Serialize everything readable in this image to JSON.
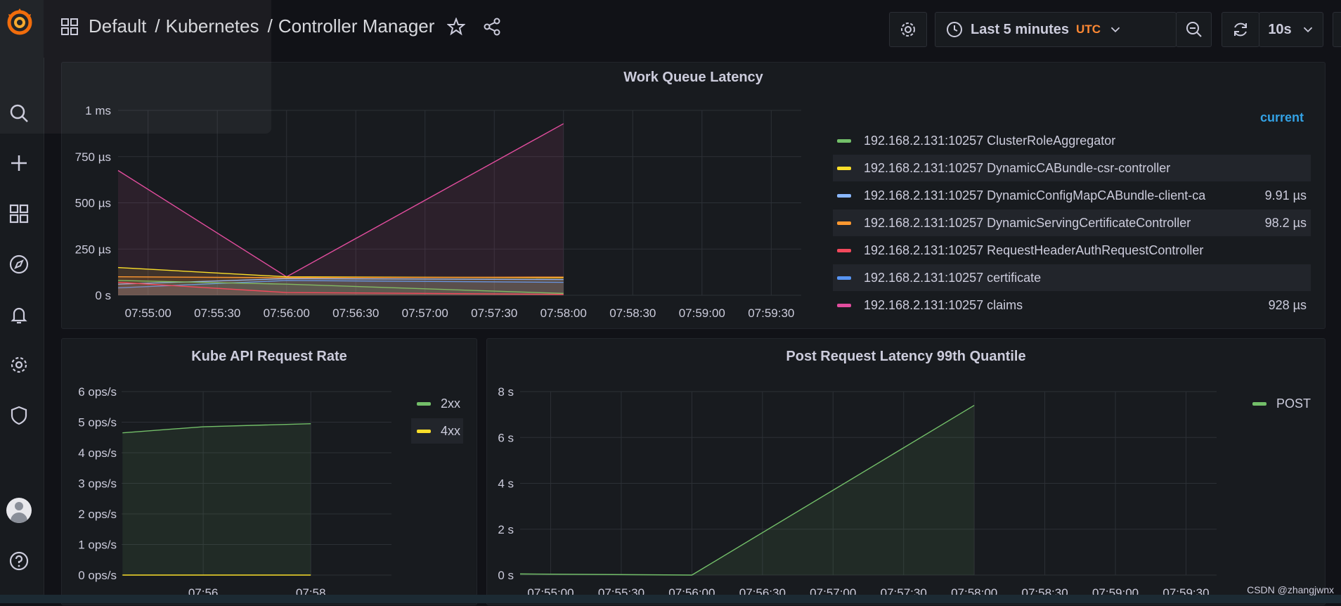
{
  "breadcrumb": {
    "folder": "Default",
    "sep1": "/",
    "parent": "Kubernetes",
    "sep2": "/",
    "dashboard": "Controller Manager"
  },
  "toolbar": {
    "time_range_label": "Last 5 minutes",
    "timezone": "UTC",
    "refresh_interval": "10s"
  },
  "sidebar": {
    "items": [
      "grafana-logo-icon",
      "search-icon",
      "plus-icon",
      "dashboards-icon",
      "explore-icon",
      "alerting-icon",
      "configuration-icon",
      "shield-icon",
      "avatar",
      "help-icon"
    ]
  },
  "colors": {
    "green": "#73bf69",
    "yellow": "#fade2a",
    "cyan": "#8ab8ff",
    "orange": "#ff9830",
    "red": "#f2495c",
    "blue": "#5794f2",
    "pink": "#e24d9e",
    "accent": "#33a2e5",
    "utc": "#ff8833"
  },
  "panels": {
    "work_queue": {
      "title": "Work Queue Latency",
      "legend_header": "current",
      "legend": [
        {
          "name": "192.168.2.131:10257 ClusterRoleAggregator",
          "value": "",
          "color": "#73bf69"
        },
        {
          "name": "192.168.2.131:10257 DynamicCABundle-csr-controller",
          "value": "",
          "color": "#fade2a"
        },
        {
          "name": "192.168.2.131:10257 DynamicConfigMapCABundle-client-ca",
          "value": "9.91 µs",
          "color": "#8ab8ff"
        },
        {
          "name": "192.168.2.131:10257 DynamicServingCertificateController",
          "value": "98.2 µs",
          "color": "#ff9830"
        },
        {
          "name": "192.168.2.131:10257 RequestHeaderAuthRequestController",
          "value": "",
          "color": "#f2495c"
        },
        {
          "name": "192.168.2.131:10257 certificate",
          "value": "",
          "color": "#5794f2"
        },
        {
          "name": "192.168.2.131:10257 claims",
          "value": "928 µs",
          "color": "#e24d9e"
        }
      ]
    },
    "api_rate": {
      "title": "Kube API Request Rate",
      "legend": [
        {
          "name": "2xx",
          "color": "#73bf69"
        },
        {
          "name": "4xx",
          "color": "#fade2a"
        }
      ]
    },
    "post_latency": {
      "title": "Post Request Latency 99th Quantile",
      "legend": [
        {
          "name": "POST",
          "color": "#73bf69"
        }
      ]
    }
  },
  "chart_data": [
    {
      "type": "line",
      "title": "Work Queue Latency",
      "x": [
        "07:54:47",
        "07:56:00",
        "07:58:00"
      ],
      "xticks": [
        "07:55:00",
        "07:55:30",
        "07:56:00",
        "07:56:30",
        "07:57:00",
        "07:57:30",
        "07:58:00",
        "07:58:30",
        "07:59:00",
        "07:59:30"
      ],
      "yticks": [
        "0 s",
        "250 µs",
        "500 µs",
        "750 µs",
        "1 ms"
      ],
      "ylim": [
        0,
        1000
      ],
      "yunit": "µs",
      "series": [
        {
          "name": "192.168.2.131:10257 claims",
          "values": [
            675,
            100,
            928
          ]
        },
        {
          "name": "192.168.2.131:10257 DynamicCABundle-csr-controller",
          "values": [
            150,
            100,
            95
          ]
        },
        {
          "name": "192.168.2.131:10257 DynamicConfigMapCABundle-client-ca",
          "values": [
            60,
            90,
            85
          ]
        },
        {
          "name": "192.168.2.131:10257 certificate",
          "values": [
            40,
            80,
            70
          ]
        },
        {
          "name": "192.168.2.131:10257 ClusterRoleAggregator",
          "values": [
            80,
            60,
            10
          ]
        },
        {
          "name": "192.168.2.131:10257 DynamicServingCertificateController",
          "values": [
            100,
            95,
            98.2
          ]
        },
        {
          "name": "192.168.2.131:10257 RequestHeaderAuthRequestController",
          "values": [
            70,
            15,
            5
          ]
        }
      ]
    },
    {
      "type": "line",
      "title": "Kube API Request Rate",
      "x": [
        "07:54:30",
        "07:56:00",
        "07:58:00"
      ],
      "xticks": [
        "07:56",
        "07:58"
      ],
      "yticks": [
        "0 ops/s",
        "1 ops/s",
        "2 ops/s",
        "3 ops/s",
        "4 ops/s",
        "5 ops/s",
        "6 ops/s"
      ],
      "ylim": [
        0,
        6
      ],
      "series": [
        {
          "name": "2xx",
          "values": [
            4.65,
            4.85,
            4.95
          ]
        },
        {
          "name": "4xx",
          "values": [
            0,
            0,
            0
          ]
        }
      ]
    },
    {
      "type": "line",
      "title": "Post Request Latency 99th Quantile",
      "x": [
        "07:54:47",
        "07:56:00",
        "07:58:00"
      ],
      "xticks": [
        "07:55:00",
        "07:55:30",
        "07:56:00",
        "07:56:30",
        "07:57:00",
        "07:57:30",
        "07:58:00",
        "07:58:30",
        "07:59:00",
        "07:59:30"
      ],
      "yticks": [
        "0 s",
        "2 s",
        "4 s",
        "6 s",
        "8 s"
      ],
      "ylim": [
        0,
        8
      ],
      "series": [
        {
          "name": "POST",
          "values": [
            0.05,
            0,
            7.4
          ]
        }
      ]
    }
  ],
  "watermark": "CSDN @zhangjwnx"
}
